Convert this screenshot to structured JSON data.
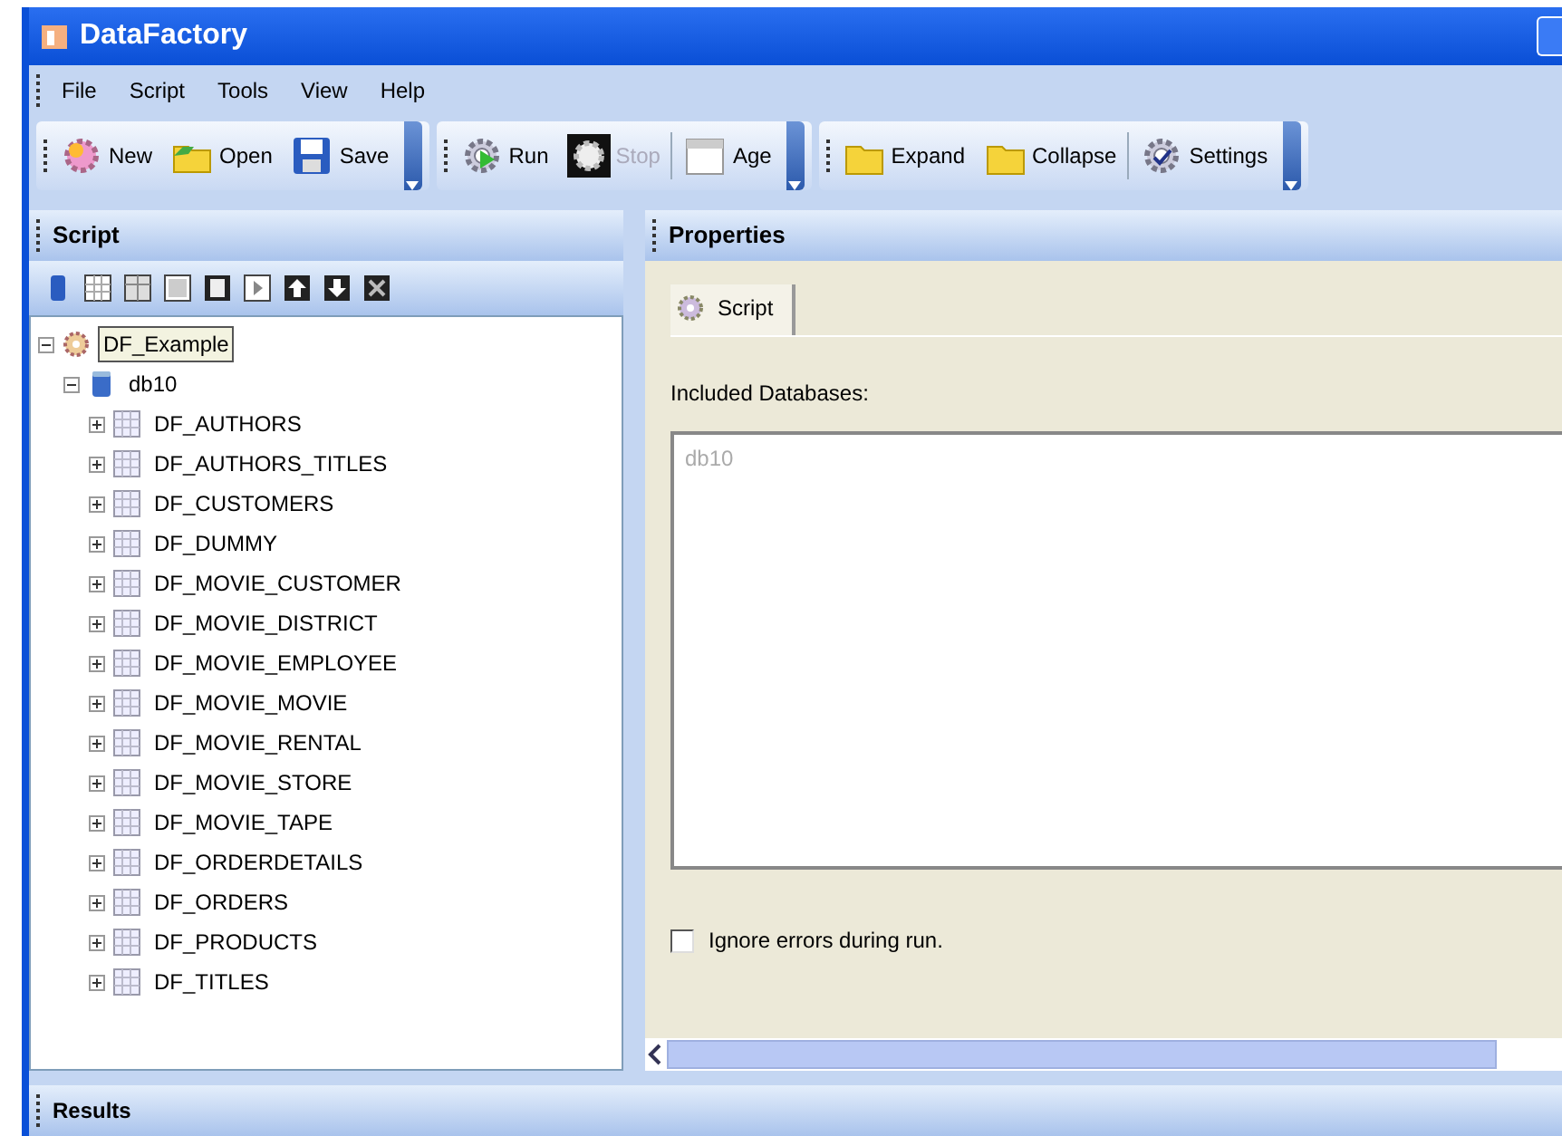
{
  "window": {
    "title": "DataFactory"
  },
  "menu": [
    {
      "label": "File"
    },
    {
      "label": "Script"
    },
    {
      "label": "Tools"
    },
    {
      "label": "View"
    },
    {
      "label": "Help"
    }
  ],
  "toolbars": [
    {
      "buttons": [
        {
          "label": "New",
          "kind": "new",
          "disabled": false
        },
        {
          "label": "Open",
          "kind": "open",
          "disabled": false
        },
        {
          "label": "Save",
          "kind": "save",
          "disabled": false
        }
      ]
    },
    {
      "buttons": [
        {
          "label": "Run",
          "kind": "run",
          "disabled": false
        },
        {
          "label": "Stop",
          "kind": "stop",
          "disabled": true
        },
        {
          "label": "Age",
          "kind": "age",
          "disabled": false
        }
      ]
    },
    {
      "buttons": [
        {
          "label": "Expand",
          "kind": "folder",
          "disabled": false
        },
        {
          "label": "Collapse",
          "kind": "folder",
          "disabled": false
        },
        {
          "label": "Settings",
          "kind": "settings",
          "disabled": false
        }
      ]
    }
  ],
  "script_panel": {
    "title": "Script",
    "tree": [
      {
        "label": "DF_Example",
        "kind": "script",
        "expanded": true,
        "selected": true,
        "children": [
          {
            "label": "db10",
            "kind": "database",
            "expanded": true,
            "selected": false,
            "children": [
              {
                "label": "DF_AUTHORS",
                "kind": "table",
                "expanded": false,
                "selected": false
              },
              {
                "label": "DF_AUTHORS_TITLES",
                "kind": "table",
                "expanded": false,
                "selected": false
              },
              {
                "label": "DF_CUSTOMERS",
                "kind": "table",
                "expanded": false,
                "selected": false
              },
              {
                "label": "DF_DUMMY",
                "kind": "table",
                "expanded": false,
                "selected": false
              },
              {
                "label": "DF_MOVIE_CUSTOMER",
                "kind": "table",
                "expanded": false,
                "selected": false
              },
              {
                "label": "DF_MOVIE_DISTRICT",
                "kind": "table",
                "expanded": false,
                "selected": false
              },
              {
                "label": "DF_MOVIE_EMPLOYEE",
                "kind": "table",
                "expanded": false,
                "selected": false
              },
              {
                "label": "DF_MOVIE_MOVIE",
                "kind": "table",
                "expanded": false,
                "selected": false
              },
              {
                "label": "DF_MOVIE_RENTAL",
                "kind": "table",
                "expanded": false,
                "selected": false
              },
              {
                "label": "DF_MOVIE_STORE",
                "kind": "table",
                "expanded": false,
                "selected": false
              },
              {
                "label": "DF_MOVIE_TAPE",
                "kind": "table",
                "expanded": false,
                "selected": false
              },
              {
                "label": "DF_ORDERDETAILS",
                "kind": "table",
                "expanded": false,
                "selected": false
              },
              {
                "label": "DF_ORDERS",
                "kind": "table",
                "expanded": false,
                "selected": false
              },
              {
                "label": "DF_PRODUCTS",
                "kind": "table",
                "expanded": false,
                "selected": false
              },
              {
                "label": "DF_TITLES",
                "kind": "table",
                "expanded": false,
                "selected": false
              }
            ]
          }
        ]
      }
    ]
  },
  "properties_panel": {
    "title": "Properties",
    "tabs": [
      {
        "label": "Script",
        "selected": true
      }
    ],
    "databases_label": "Included Databases:",
    "databases": [
      {
        "label": "db10",
        "disabled": true
      }
    ],
    "ignore_errors": {
      "label": "Ignore errors during run.",
      "checked": false
    }
  },
  "results_panel": {
    "title": "Results"
  }
}
